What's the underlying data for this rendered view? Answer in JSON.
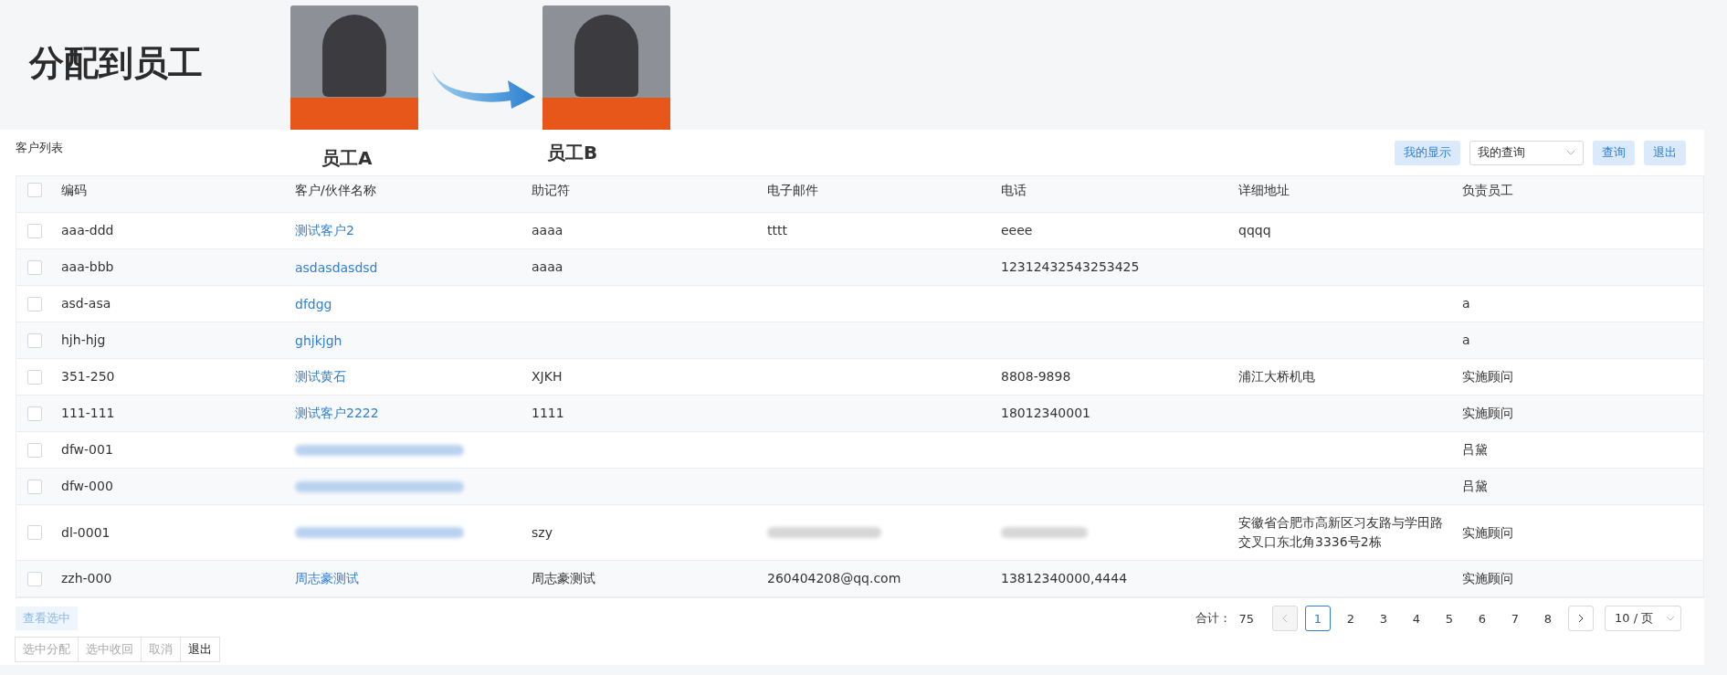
{
  "header": {
    "title": "分配到员工",
    "employees": [
      {
        "label": "员工A"
      },
      {
        "label": "员工B"
      }
    ]
  },
  "panel": {
    "title": "客户列表",
    "toolbar": [
      {
        "kind": "button",
        "label": "我的显示"
      },
      {
        "kind": "select",
        "value": "我的查询"
      },
      {
        "kind": "button",
        "label": "查询"
      },
      {
        "kind": "button",
        "label": "退出"
      }
    ]
  },
  "table": {
    "select_all": {
      "checked": false
    },
    "columns": [
      "编码",
      "客户/伙伴名称",
      "助记符",
      "电子邮件",
      "电话",
      "详细地址",
      "负责员工"
    ],
    "rows": [
      {
        "checked": false,
        "code": "aaa-ddd",
        "name": "测试客户2",
        "mnemonic": "aaaa",
        "email": "tttt",
        "phone": "eeee",
        "address": "qqqq"
      },
      {
        "checked": false,
        "code": "aaa-bbb",
        "name": "asdasdasdsd",
        "mnemonic": "aaaa",
        "phone": "12312432543253425"
      },
      {
        "checked": false,
        "code": "asd-asa",
        "name": "dfdgg",
        "owner": "a"
      },
      {
        "checked": false,
        "code": "hjh-hjg",
        "name": "ghjkjgh",
        "owner": "a"
      },
      {
        "checked": false,
        "code": "351-250",
        "name": "测试黄石",
        "mnemonic": "XJKH",
        "phone": "8808-9898",
        "address": "浦江大桥机电",
        "owner": "实施顾问"
      },
      {
        "checked": false,
        "code": "111-111",
        "name": "测试客户2222",
        "mnemonic": "1111",
        "phone": "18012340001",
        "owner": "实施顾问"
      },
      {
        "checked": false,
        "code": "dfw-001",
        "name": {
          "redacted": true
        },
        "owner": "吕黛"
      },
      {
        "checked": false,
        "code": "dfw-000",
        "name": {
          "redacted": true
        },
        "owner": "吕黛"
      },
      {
        "checked": false,
        "code": "dl-0001",
        "name": {
          "redacted": true
        },
        "mnemonic": "szy",
        "email": {
          "redacted": true
        },
        "phone": {
          "redacted": true
        },
        "address": "安徽省合肥市高新区习友路与学田路交叉口东北角3336号2栋",
        "owner": "实施顾问"
      },
      {
        "checked": false,
        "code": "zzh-000",
        "name": "周志豪测试",
        "mnemonic": "周志豪测试",
        "email": "260404208@qq.com",
        "phone": "13812340000,4444",
        "owner": "实施顾问"
      }
    ]
  },
  "view_selected": {
    "label": "查看选中",
    "disabled": true
  },
  "pagination": {
    "total_label": "合计：",
    "total": "75",
    "prev": {
      "disabled": true
    },
    "pages": [
      {
        "label": "1",
        "selected": true
      },
      {
        "label": "2",
        "selected": false
      },
      {
        "label": "3",
        "selected": false
      },
      {
        "label": "4",
        "selected": false
      },
      {
        "label": "5",
        "selected": false
      },
      {
        "label": "6",
        "selected": false
      },
      {
        "label": "7",
        "selected": false
      },
      {
        "label": "8",
        "selected": false
      }
    ],
    "next": {
      "disabled": false
    },
    "page_size": "10 / 页"
  },
  "actions": [
    {
      "label": "选中分配",
      "disabled": true
    },
    {
      "label": "选中收回",
      "disabled": true
    },
    {
      "label": "取消",
      "disabled": true
    },
    {
      "label": "退出",
      "disabled": false
    }
  ]
}
